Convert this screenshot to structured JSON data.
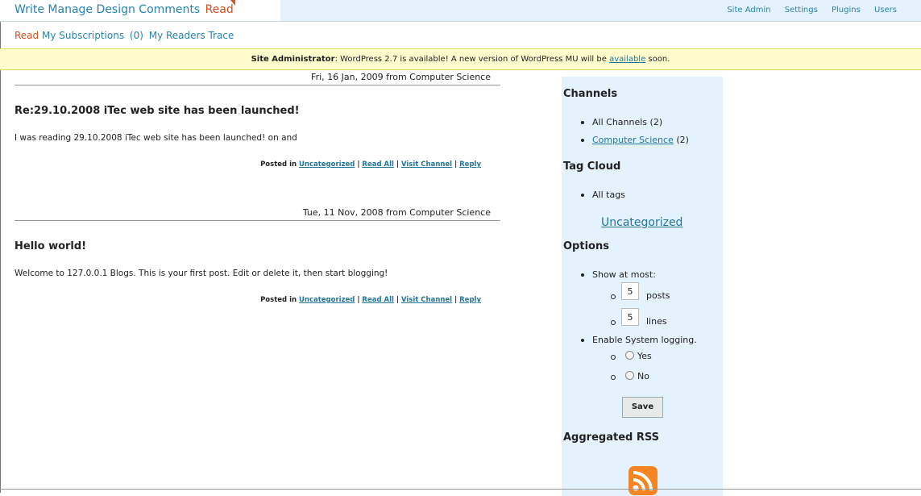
{
  "top_nav": {
    "items": [
      "Write",
      "Manage",
      "Design",
      "Comments"
    ],
    "current": "Read"
  },
  "admin_nav": [
    "Site Admin",
    "Settings",
    "Plugins",
    "Users"
  ],
  "sub_nav": {
    "current": "Read",
    "subscriptions": "My Subscriptions",
    "count": "(0)",
    "readers_trace": "My Readers Trace"
  },
  "notice": {
    "label": "Site Administrator",
    "text": ": WordPress 2.7 is available! A new version of WordPress MU will be",
    "link": "available",
    "tail": "soon."
  },
  "posts": [
    {
      "date": "Fri, 16 Jan, 2009 from Computer Science",
      "title": "Re:29.10.2008 iTec web site has been launched!",
      "body": "I was reading 29.10.2008 iTec web site has been launched! on and",
      "posted_in": "Posted in",
      "category": "Uncategorized",
      "read_all": "Read All",
      "visit_channel": "Visit Channel",
      "reply": "Reply"
    },
    {
      "date": "Tue, 11 Nov, 2008 from Computer Science",
      "title": "Hello world!",
      "body": "Welcome to 127.0.0.1 Blogs. This is your first post. Edit or delete it, then start blogging!",
      "posted_in": "Posted in",
      "category": "Uncategorized",
      "read_all": "Read All",
      "visit_channel": "Visit Channel",
      "reply": "Reply"
    }
  ],
  "sidebar": {
    "channels_title": "Channels",
    "all_channels": "All Channels",
    "all_channels_count": "(2)",
    "computer_science": "Computer Science",
    "computer_science_count": "(2)",
    "tag_cloud_title": "Tag Cloud",
    "all_tags": "All tags",
    "tag": "Uncategorized",
    "options_title": "Options",
    "show_at_most": "Show at most:",
    "posts_value": "5",
    "posts_label": "posts",
    "lines_value": "5",
    "lines_label": "lines",
    "enable_logging": "Enable System logging.",
    "yes": "Yes",
    "no": "No",
    "save": "Save",
    "rss_title": "Aggregated RSS"
  }
}
